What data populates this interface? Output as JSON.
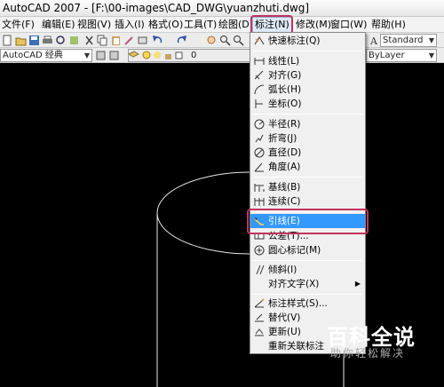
{
  "window": {
    "title": "AutoCAD 2007 - [F:\\00-images\\CAD_DWG\\yuanzhuti.dwg]"
  },
  "menubar": {
    "items": [
      {
        "label": "文件(F)"
      },
      {
        "label": "编辑(E)"
      },
      {
        "label": "视图(V)"
      },
      {
        "label": "插入(I)"
      },
      {
        "label": "格式(O)"
      },
      {
        "label": "工具(T)"
      },
      {
        "label": "绘图(D)"
      },
      {
        "label": "标注(N)"
      },
      {
        "label": "修改(M)"
      },
      {
        "label": "窗口(W)"
      },
      {
        "label": "帮助(H)"
      }
    ]
  },
  "toolbar": {
    "workspace": "AutoCAD 经典",
    "layer": "0",
    "text_style": "Standard",
    "linetype": "ByLayer"
  },
  "dimension_menu": {
    "items": [
      {
        "label": "快速标注(Q)",
        "icon": "quick-dimension-icon"
      },
      {
        "label": "线性(L)",
        "icon": "linear-dimension-icon"
      },
      {
        "label": "对齐(G)",
        "icon": "aligned-dimension-icon"
      },
      {
        "label": "弧长(H)",
        "icon": "arc-length-icon"
      },
      {
        "label": "坐标(O)",
        "icon": "ordinate-icon"
      },
      {
        "label": "半径(R)",
        "icon": "radius-icon"
      },
      {
        "label": "折弯(J)",
        "icon": "jogged-icon"
      },
      {
        "label": "直径(D)",
        "icon": "diameter-icon"
      },
      {
        "label": "角度(A)",
        "icon": "angular-icon"
      },
      {
        "label": "基线(B)",
        "icon": "baseline-icon"
      },
      {
        "label": "连续(C)",
        "icon": "continue-icon"
      },
      {
        "label": "引线(E)",
        "icon": "leader-icon"
      },
      {
        "label": "公差(T)...",
        "icon": "tolerance-icon"
      },
      {
        "label": "圆心标记(M)",
        "icon": "center-mark-icon"
      },
      {
        "label": "倾斜(I)",
        "icon": "oblique-icon"
      },
      {
        "label": "对齐文字(X)",
        "icon": ""
      },
      {
        "label": "标注样式(S)...",
        "icon": "dimension-style-icon"
      },
      {
        "label": "替代(V)",
        "icon": "override-icon"
      },
      {
        "label": "更新(U)",
        "icon": "update-icon"
      },
      {
        "label": "重新关联标注",
        "icon": ""
      }
    ],
    "highlighted_index": 11
  },
  "watermark": {
    "brand": "百科全说",
    "subtitle": "助你轻松解决"
  },
  "colors": {
    "highlight": "#3399ff",
    "annotation": "#c0335f",
    "canvas": "#000000"
  }
}
